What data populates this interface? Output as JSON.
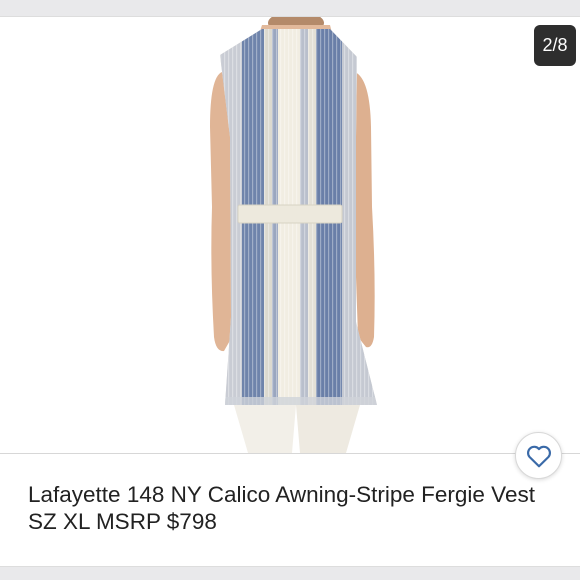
{
  "listing": {
    "image_counter": "2/8",
    "title": "Lafayette 148 NY Calico Awning-Stripe Fergie Vest SZ XL MSRP $798"
  },
  "icons": {
    "like": "heart-outline-icon"
  },
  "colors": {
    "accent": "#3a6aa8",
    "counter_bg": "#2e2e2e",
    "stripe_blue": "#6a7fa8",
    "stripe_cream": "#ece8dc"
  }
}
